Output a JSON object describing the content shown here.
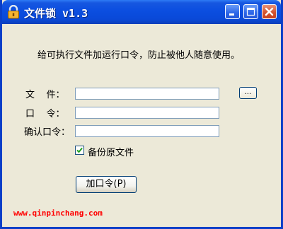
{
  "window": {
    "title": "文件锁 v1.3",
    "title_color": "#ffffff",
    "titlebar_color": "#0a49d8",
    "icon": "padlock-icon",
    "controls": [
      "minimize-icon",
      "maximize-icon",
      "close-icon"
    ]
  },
  "form": {
    "description": "给可执行文件加运行口令，防止被他人随意使用。",
    "file_label": "文    件：",
    "file_value": "",
    "browse_label": "...",
    "password_label": "口    令：",
    "password_value": "",
    "confirm_label": "确认口令：",
    "confirm_value": "",
    "backup_checked": true,
    "backup_label": "备份原文件",
    "add_button_label": "加口令(P)"
  },
  "footer": {
    "url": "www.qinpinchang.com",
    "url_color": "#ff0000"
  }
}
